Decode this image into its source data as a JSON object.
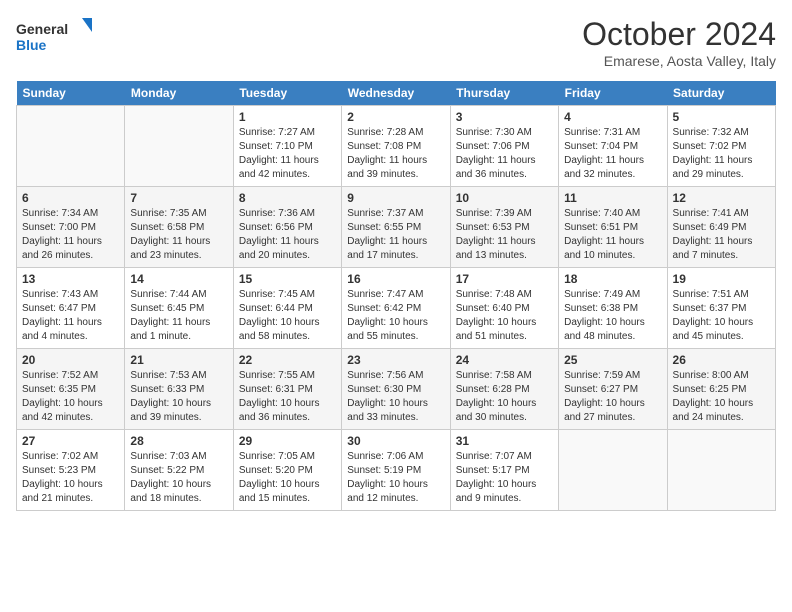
{
  "logo": {
    "line1": "General",
    "line2": "Blue"
  },
  "title": "October 2024",
  "subtitle": "Emarese, Aosta Valley, Italy",
  "weekdays": [
    "Sunday",
    "Monday",
    "Tuesday",
    "Wednesday",
    "Thursday",
    "Friday",
    "Saturday"
  ],
  "weeks": [
    [
      {
        "day": "",
        "sunrise": "",
        "sunset": "",
        "daylight": ""
      },
      {
        "day": "",
        "sunrise": "",
        "sunset": "",
        "daylight": ""
      },
      {
        "day": "1",
        "sunrise": "Sunrise: 7:27 AM",
        "sunset": "Sunset: 7:10 PM",
        "daylight": "Daylight: 11 hours and 42 minutes."
      },
      {
        "day": "2",
        "sunrise": "Sunrise: 7:28 AM",
        "sunset": "Sunset: 7:08 PM",
        "daylight": "Daylight: 11 hours and 39 minutes."
      },
      {
        "day": "3",
        "sunrise": "Sunrise: 7:30 AM",
        "sunset": "Sunset: 7:06 PM",
        "daylight": "Daylight: 11 hours and 36 minutes."
      },
      {
        "day": "4",
        "sunrise": "Sunrise: 7:31 AM",
        "sunset": "Sunset: 7:04 PM",
        "daylight": "Daylight: 11 hours and 32 minutes."
      },
      {
        "day": "5",
        "sunrise": "Sunrise: 7:32 AM",
        "sunset": "Sunset: 7:02 PM",
        "daylight": "Daylight: 11 hours and 29 minutes."
      }
    ],
    [
      {
        "day": "6",
        "sunrise": "Sunrise: 7:34 AM",
        "sunset": "Sunset: 7:00 PM",
        "daylight": "Daylight: 11 hours and 26 minutes."
      },
      {
        "day": "7",
        "sunrise": "Sunrise: 7:35 AM",
        "sunset": "Sunset: 6:58 PM",
        "daylight": "Daylight: 11 hours and 23 minutes."
      },
      {
        "day": "8",
        "sunrise": "Sunrise: 7:36 AM",
        "sunset": "Sunset: 6:56 PM",
        "daylight": "Daylight: 11 hours and 20 minutes."
      },
      {
        "day": "9",
        "sunrise": "Sunrise: 7:37 AM",
        "sunset": "Sunset: 6:55 PM",
        "daylight": "Daylight: 11 hours and 17 minutes."
      },
      {
        "day": "10",
        "sunrise": "Sunrise: 7:39 AM",
        "sunset": "Sunset: 6:53 PM",
        "daylight": "Daylight: 11 hours and 13 minutes."
      },
      {
        "day": "11",
        "sunrise": "Sunrise: 7:40 AM",
        "sunset": "Sunset: 6:51 PM",
        "daylight": "Daylight: 11 hours and 10 minutes."
      },
      {
        "day": "12",
        "sunrise": "Sunrise: 7:41 AM",
        "sunset": "Sunset: 6:49 PM",
        "daylight": "Daylight: 11 hours and 7 minutes."
      }
    ],
    [
      {
        "day": "13",
        "sunrise": "Sunrise: 7:43 AM",
        "sunset": "Sunset: 6:47 PM",
        "daylight": "Daylight: 11 hours and 4 minutes."
      },
      {
        "day": "14",
        "sunrise": "Sunrise: 7:44 AM",
        "sunset": "Sunset: 6:45 PM",
        "daylight": "Daylight: 11 hours and 1 minute."
      },
      {
        "day": "15",
        "sunrise": "Sunrise: 7:45 AM",
        "sunset": "Sunset: 6:44 PM",
        "daylight": "Daylight: 10 hours and 58 minutes."
      },
      {
        "day": "16",
        "sunrise": "Sunrise: 7:47 AM",
        "sunset": "Sunset: 6:42 PM",
        "daylight": "Daylight: 10 hours and 55 minutes."
      },
      {
        "day": "17",
        "sunrise": "Sunrise: 7:48 AM",
        "sunset": "Sunset: 6:40 PM",
        "daylight": "Daylight: 10 hours and 51 minutes."
      },
      {
        "day": "18",
        "sunrise": "Sunrise: 7:49 AM",
        "sunset": "Sunset: 6:38 PM",
        "daylight": "Daylight: 10 hours and 48 minutes."
      },
      {
        "day": "19",
        "sunrise": "Sunrise: 7:51 AM",
        "sunset": "Sunset: 6:37 PM",
        "daylight": "Daylight: 10 hours and 45 minutes."
      }
    ],
    [
      {
        "day": "20",
        "sunrise": "Sunrise: 7:52 AM",
        "sunset": "Sunset: 6:35 PM",
        "daylight": "Daylight: 10 hours and 42 minutes."
      },
      {
        "day": "21",
        "sunrise": "Sunrise: 7:53 AM",
        "sunset": "Sunset: 6:33 PM",
        "daylight": "Daylight: 10 hours and 39 minutes."
      },
      {
        "day": "22",
        "sunrise": "Sunrise: 7:55 AM",
        "sunset": "Sunset: 6:31 PM",
        "daylight": "Daylight: 10 hours and 36 minutes."
      },
      {
        "day": "23",
        "sunrise": "Sunrise: 7:56 AM",
        "sunset": "Sunset: 6:30 PM",
        "daylight": "Daylight: 10 hours and 33 minutes."
      },
      {
        "day": "24",
        "sunrise": "Sunrise: 7:58 AM",
        "sunset": "Sunset: 6:28 PM",
        "daylight": "Daylight: 10 hours and 30 minutes."
      },
      {
        "day": "25",
        "sunrise": "Sunrise: 7:59 AM",
        "sunset": "Sunset: 6:27 PM",
        "daylight": "Daylight: 10 hours and 27 minutes."
      },
      {
        "day": "26",
        "sunrise": "Sunrise: 8:00 AM",
        "sunset": "Sunset: 6:25 PM",
        "daylight": "Daylight: 10 hours and 24 minutes."
      }
    ],
    [
      {
        "day": "27",
        "sunrise": "Sunrise: 7:02 AM",
        "sunset": "Sunset: 5:23 PM",
        "daylight": "Daylight: 10 hours and 21 minutes."
      },
      {
        "day": "28",
        "sunrise": "Sunrise: 7:03 AM",
        "sunset": "Sunset: 5:22 PM",
        "daylight": "Daylight: 10 hours and 18 minutes."
      },
      {
        "day": "29",
        "sunrise": "Sunrise: 7:05 AM",
        "sunset": "Sunset: 5:20 PM",
        "daylight": "Daylight: 10 hours and 15 minutes."
      },
      {
        "day": "30",
        "sunrise": "Sunrise: 7:06 AM",
        "sunset": "Sunset: 5:19 PM",
        "daylight": "Daylight: 10 hours and 12 minutes."
      },
      {
        "day": "31",
        "sunrise": "Sunrise: 7:07 AM",
        "sunset": "Sunset: 5:17 PM",
        "daylight": "Daylight: 10 hours and 9 minutes."
      },
      {
        "day": "",
        "sunrise": "",
        "sunset": "",
        "daylight": ""
      },
      {
        "day": "",
        "sunrise": "",
        "sunset": "",
        "daylight": ""
      }
    ]
  ]
}
